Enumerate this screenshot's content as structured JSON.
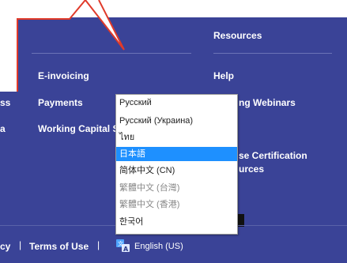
{
  "footer": {
    "resources_heading": "Resources",
    "col1": [
      "E-invoicing",
      "Payments",
      "Working Capital S"
    ],
    "col0_partial": [
      "ss",
      "a"
    ],
    "col3": [
      "Help",
      "ng Webinars",
      "se Certification",
      "urces"
    ],
    "legal": {
      "privacy_partial": "cy",
      "terms": "Terms of Use",
      "separator": "|"
    },
    "language": {
      "label": "English (US)",
      "icon": "language-translate-icon"
    }
  },
  "language_dropdown": {
    "options": [
      "Русский",
      "Русский (Украина)",
      "ไทย",
      "日本語",
      "简体中文 (CN)",
      "繁體中文 (台灣)",
      "繁體中文 (香港)",
      "한국어"
    ],
    "selected_index": 3
  },
  "colors": {
    "footer_bg": "#3a4397",
    "callout_outline": "#e03a2a",
    "selection": "#1e90ff"
  }
}
